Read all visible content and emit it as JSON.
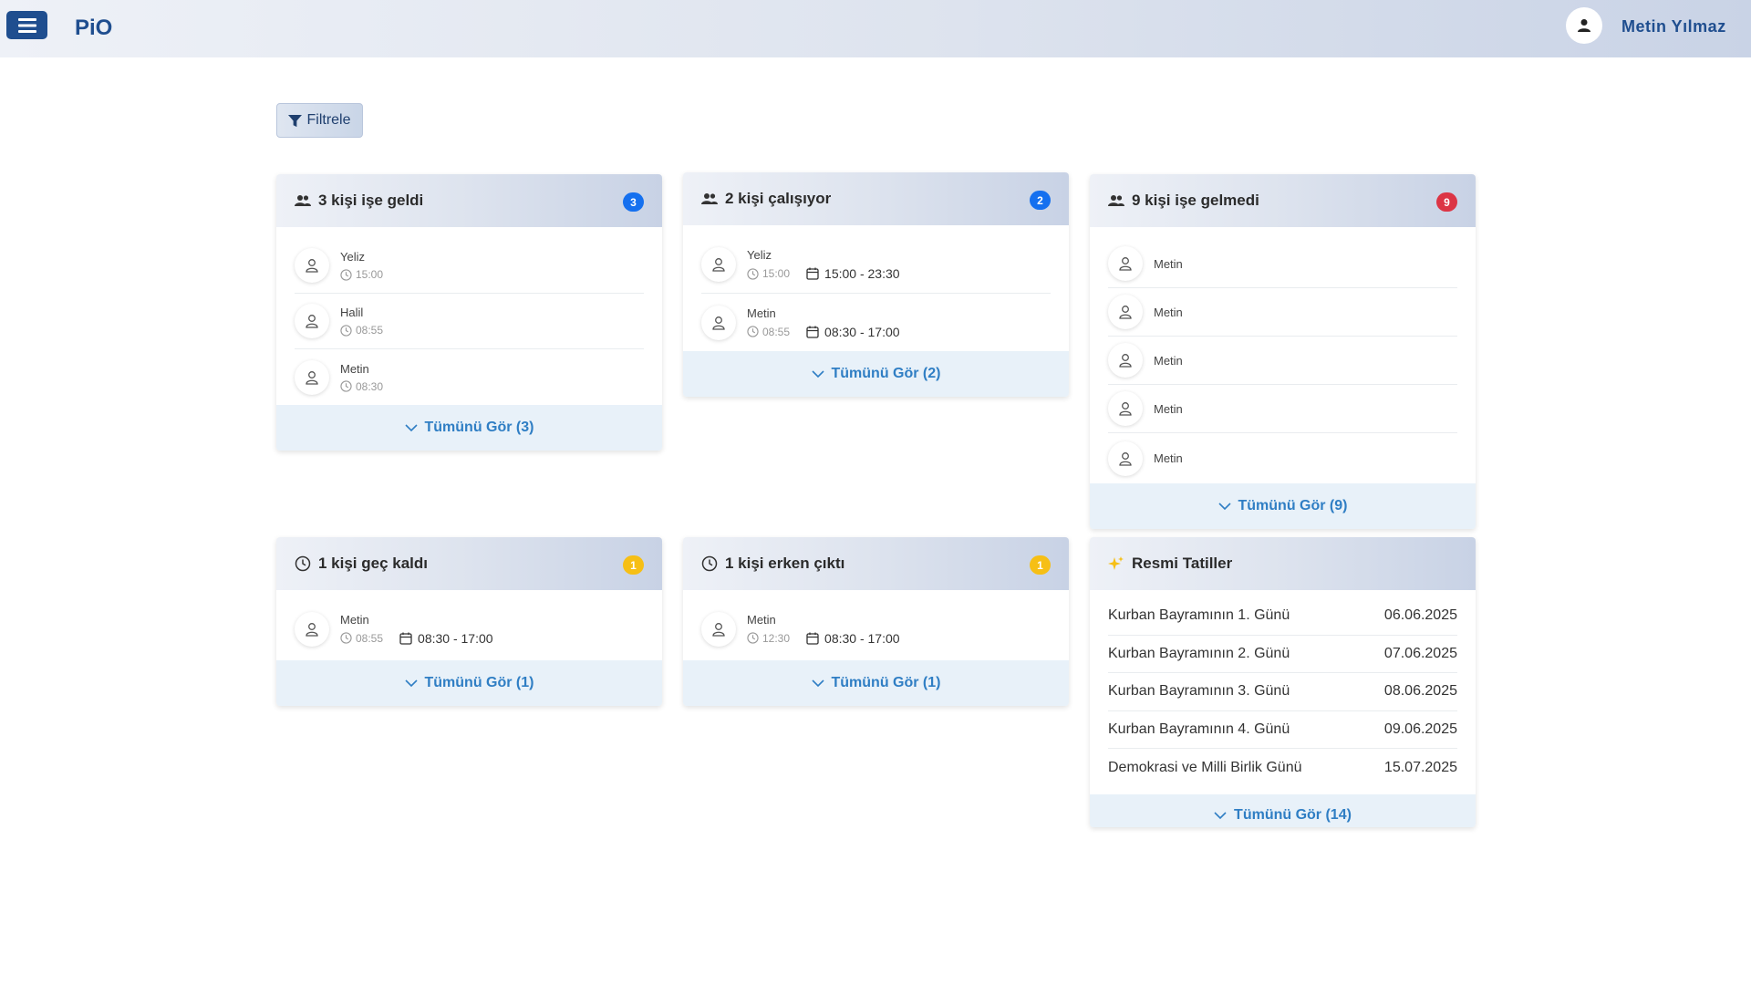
{
  "header": {
    "logo": "PiO",
    "user_name": "Metin Yılmaz"
  },
  "filter": {
    "label": "Filtrele"
  },
  "colors": {
    "brand": "#1f4e8f",
    "link": "#2f7ec4",
    "badge_blue": "#1570ef",
    "badge_red": "#dc3545",
    "badge_yellow": "#f6bf15"
  },
  "cards": {
    "came": {
      "title": "3 kişi işe geldi",
      "badge": "3",
      "icon": "users-icon",
      "rows": [
        {
          "name": "Yeliz",
          "time": "15:00"
        },
        {
          "name": "Halil",
          "time": "08:55"
        },
        {
          "name": "Metin",
          "time": "08:30"
        }
      ],
      "footer": "Tümünü Gör (3)"
    },
    "working": {
      "title": "2 kişi çalışıyor",
      "badge": "2",
      "icon": "users-icon",
      "rows": [
        {
          "name": "Yeliz",
          "time": "15:00",
          "shift": "15:00 - 23:30"
        },
        {
          "name": "Metin",
          "time": "08:55",
          "shift": "08:30 - 17:00"
        }
      ],
      "footer": "Tümünü Gör (2)"
    },
    "absent": {
      "title": "9 kişi işe gelmedi",
      "badge": "9",
      "icon": "users-icon",
      "rows": [
        {
          "name": "Metin"
        },
        {
          "name": "Metin"
        },
        {
          "name": "Metin"
        },
        {
          "name": "Metin"
        },
        {
          "name": "Metin"
        }
      ],
      "footer": "Tümünü Gör (9)"
    },
    "late": {
      "title": "1 kişi geç kaldı",
      "badge": "1",
      "icon": "clock-icon",
      "rows": [
        {
          "name": "Metin",
          "time": "08:55",
          "shift": "08:30 - 17:00"
        }
      ],
      "footer": "Tümünü Gör (1)"
    },
    "early": {
      "title": "1 kişi erken çıktı",
      "badge": "1",
      "icon": "clock-icon",
      "rows": [
        {
          "name": "Metin",
          "time": "12:30",
          "shift": "08:30 - 17:00"
        }
      ],
      "footer": "Tümünü Gör (1)"
    },
    "holidays": {
      "title": "Resmi Tatiller",
      "icon": "sparkle-icon",
      "rows": [
        {
          "name": "Kurban Bayramının 1. Günü",
          "date": "06.06.2025"
        },
        {
          "name": "Kurban Bayramının 2. Günü",
          "date": "07.06.2025"
        },
        {
          "name": "Kurban Bayramının 3. Günü",
          "date": "08.06.2025"
        },
        {
          "name": "Kurban Bayramının 4. Günü",
          "date": "09.06.2025"
        },
        {
          "name": "Demokrasi ve Milli Birlik Günü",
          "date": "15.07.2025"
        }
      ],
      "footer": "Tümünü Gör (14)"
    }
  }
}
